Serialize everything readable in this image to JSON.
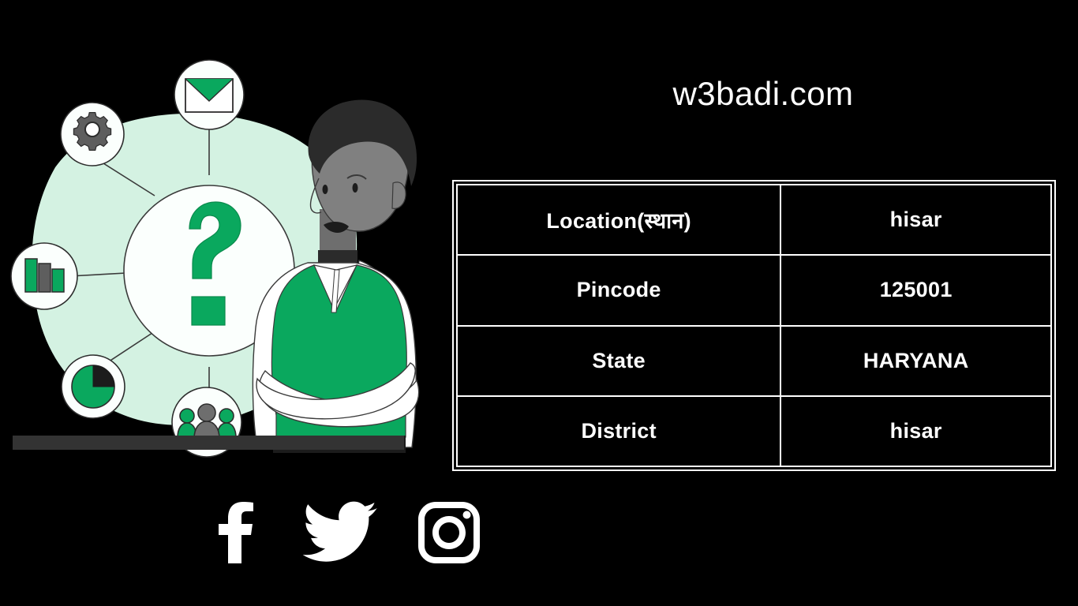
{
  "brand": {
    "title": "w3badi.com"
  },
  "table": {
    "rows": [
      {
        "label": "Location(स्थान)",
        "value": "hisar"
      },
      {
        "label": "Pincode",
        "value": "125001"
      },
      {
        "label": "State",
        "value": "HARYANA"
      },
      {
        "label": "District",
        "value": "hisar"
      }
    ]
  },
  "social": {
    "items": [
      {
        "icon": "facebook-icon",
        "name": "Facebook"
      },
      {
        "icon": "twitter-icon",
        "name": "Twitter"
      },
      {
        "icon": "instagram-icon",
        "name": "Instagram"
      }
    ]
  },
  "illustration": {
    "alt": "Person with question mark and connected data icons",
    "nodes": [
      {
        "icon": "envelope-icon",
        "name": "Email"
      },
      {
        "icon": "gear-icon",
        "name": "Settings"
      },
      {
        "icon": "bar-chart-icon",
        "name": "Statistics"
      },
      {
        "icon": "pie-chart-icon",
        "name": "Analytics"
      },
      {
        "icon": "people-icon",
        "name": "Community"
      },
      {
        "icon": "question-mark-icon",
        "name": "Question"
      }
    ]
  },
  "colors": {
    "background": "#000000",
    "accent_green": "#0aa85e",
    "mint_blob": "#d4f2e2",
    "text_white": "#ffffff",
    "gray_mid": "#808080",
    "gray_dark": "#2b2b2b",
    "floor_bar": "#333333"
  }
}
